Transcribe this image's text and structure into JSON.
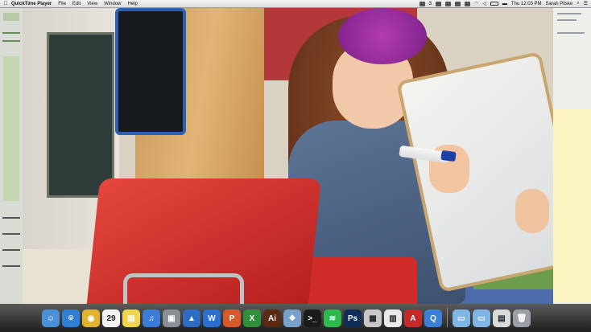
{
  "menubar": {
    "apple": "",
    "app_name": "QuickTime Player",
    "menus": [
      "File",
      "Edit",
      "View",
      "Window",
      "Help"
    ],
    "status_badge": "3",
    "clock": "Thu 12:03 PM",
    "user": "Sarah Pliske"
  },
  "dock": {
    "icons": [
      {
        "name": "finder-icon",
        "glyph": "☺",
        "color": "#4a8fd8"
      },
      {
        "name": "safari-icon",
        "glyph": "⌾",
        "color": "#2f7fd6"
      },
      {
        "name": "chrome-icon",
        "glyph": "◉",
        "color": "#e0b22f"
      },
      {
        "name": "calendar-icon",
        "glyph": "29",
        "color": "#f2f2f2"
      },
      {
        "name": "stickies-icon",
        "glyph": "▤",
        "color": "#f2d64a"
      },
      {
        "name": "itunes-icon",
        "glyph": "♫",
        "color": "#3a7bd5"
      },
      {
        "name": "preview-icon",
        "glyph": "▣",
        "color": "#8a8f96"
      },
      {
        "name": "keynote-icon",
        "glyph": "▲",
        "color": "#2d6cc4"
      },
      {
        "name": "word-icon",
        "glyph": "W",
        "color": "#2b6fd1"
      },
      {
        "name": "powerpoint-icon",
        "glyph": "P",
        "color": "#d65a2b"
      },
      {
        "name": "excel-icon",
        "glyph": "X",
        "color": "#2f8f3a"
      },
      {
        "name": "illustrator-icon",
        "glyph": "Ai",
        "color": "#5a2a12"
      },
      {
        "name": "image-capture-icon",
        "glyph": "❖",
        "color": "#7aa0c8"
      },
      {
        "name": "terminal-icon",
        "glyph": ">_",
        "color": "#1b1b1b"
      },
      {
        "name": "spotify-icon",
        "glyph": "≋",
        "color": "#2fb84b"
      },
      {
        "name": "photoshop-icon",
        "glyph": "Ps",
        "color": "#0f2f5a"
      },
      {
        "name": "file-icon",
        "glyph": "▦",
        "color": "#c8c8c8"
      },
      {
        "name": "document-icon",
        "glyph": "▥",
        "color": "#eaeaea"
      },
      {
        "name": "acrobat-icon",
        "glyph": "A",
        "color": "#c42a2a"
      },
      {
        "name": "quicktime-icon",
        "glyph": "Q",
        "color": "#3c7fd8"
      },
      {
        "name": "applications-folder-icon",
        "glyph": "▭",
        "color": "#7fb6e6"
      },
      {
        "name": "documents-folder-icon",
        "glyph": "▭",
        "color": "#7fb6e6"
      },
      {
        "name": "downloads-stack-icon",
        "glyph": "▤",
        "color": "#d9d9d9"
      },
      {
        "name": "trash-icon",
        "glyph": "🗑",
        "color": "#9aa0a6"
      }
    ]
  }
}
